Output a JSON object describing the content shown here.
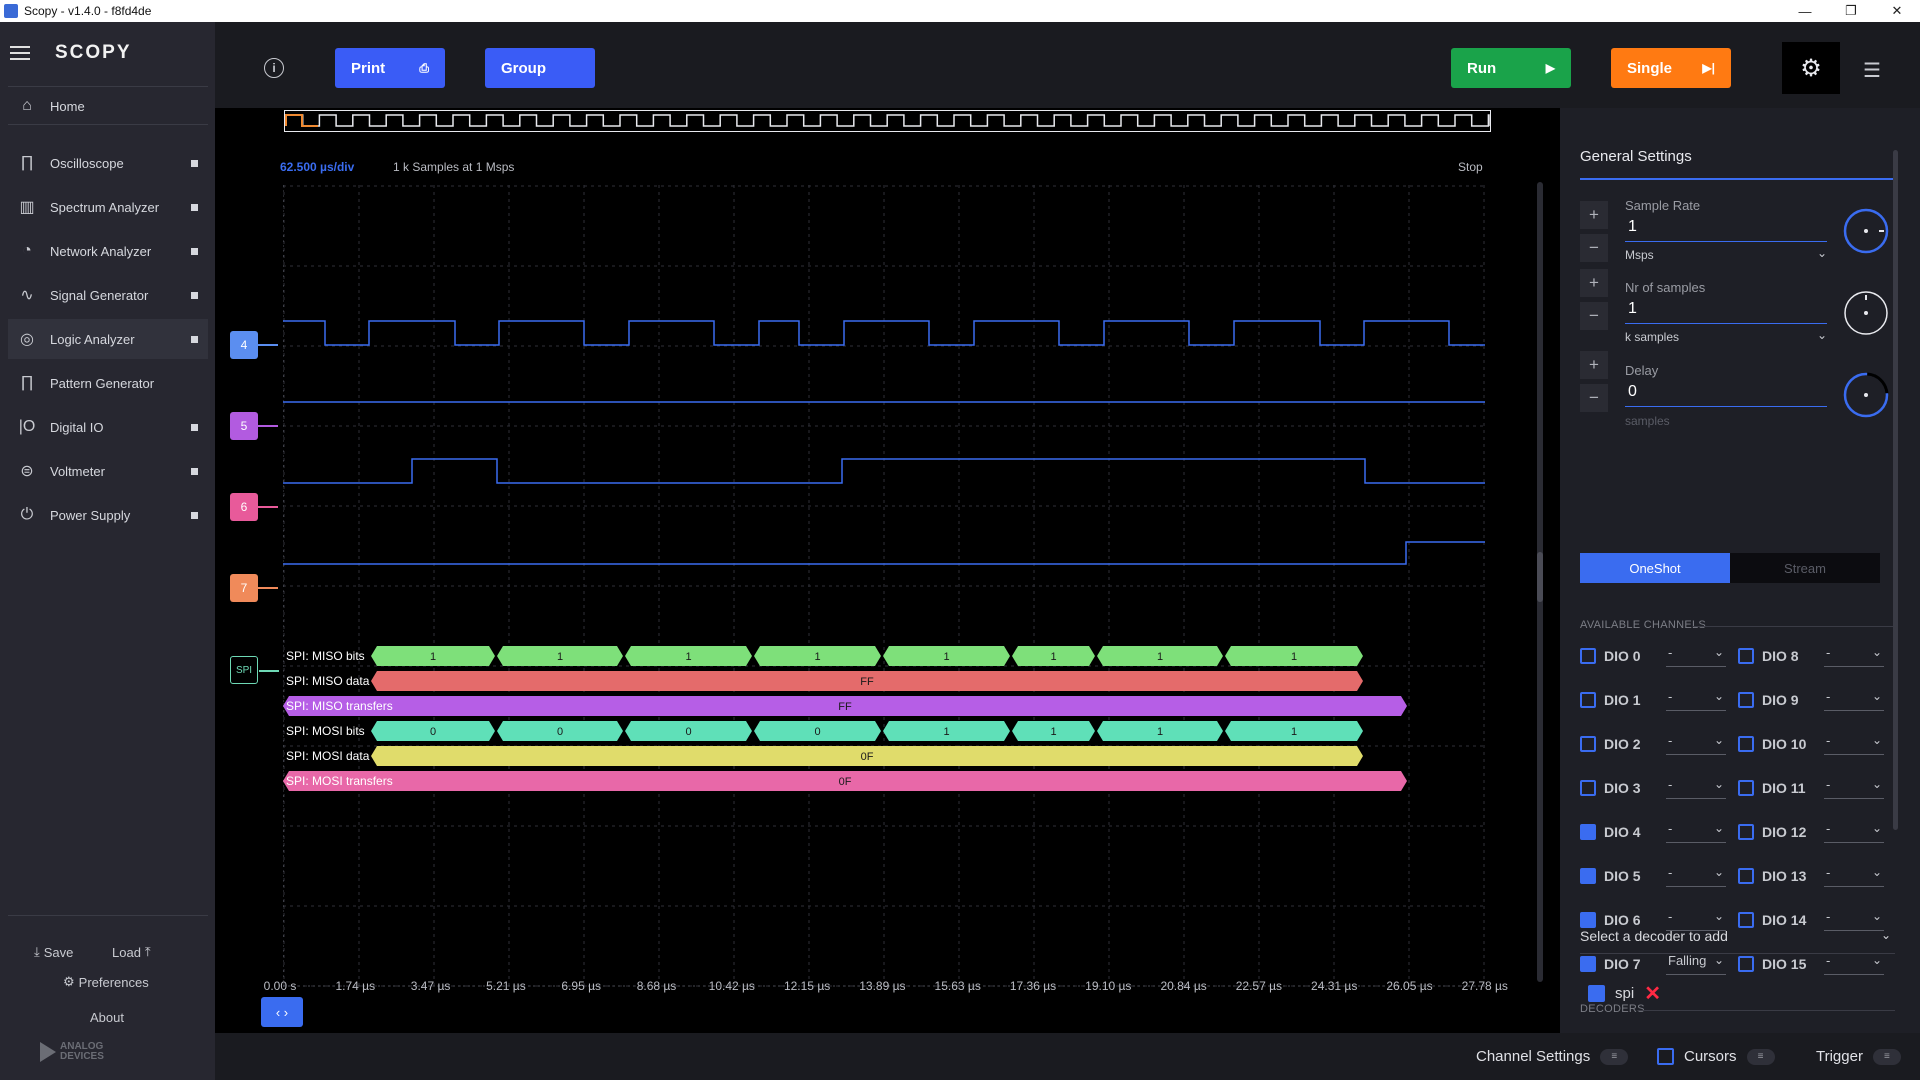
{
  "window": {
    "title": "Scopy - v1.4.0 - f8fd4de",
    "controls": [
      "—",
      "❐",
      "✕"
    ]
  },
  "sidebar": {
    "logo": "SCOPY",
    "home_label": "Home",
    "items": [
      {
        "label": "Oscilloscope",
        "icon": "oscilloscope-icon"
      },
      {
        "label": "Spectrum Analyzer",
        "icon": "spectrum-icon"
      },
      {
        "label": "Network Analyzer",
        "icon": "network-icon"
      },
      {
        "label": "Signal Generator",
        "icon": "signal-icon"
      },
      {
        "label": "Logic Analyzer",
        "icon": "logic-icon"
      },
      {
        "label": "Pattern Generator",
        "icon": "pattern-icon"
      },
      {
        "label": "Digital IO",
        "icon": "digital-io-icon"
      },
      {
        "label": "Voltmeter",
        "icon": "voltmeter-icon"
      },
      {
        "label": "Power Supply",
        "icon": "power-icon"
      }
    ],
    "save_label": "Save",
    "load_label": "Load",
    "preferences_label": "Preferences",
    "about_label": "About",
    "brand_line1": "ANALOG",
    "brand_line2": "DEVICES"
  },
  "toolbar": {
    "print_label": "Print",
    "group_label": "Group",
    "run_label": "Run",
    "single_label": "Single",
    "colors": {
      "print": "#3a5cf6",
      "group": "#3a5cf6",
      "run": "#1aa34a",
      "single": "#ff7a12"
    }
  },
  "plot": {
    "time_div": "62.500 µs/div",
    "samples_info": "1 k Samples at 1 Msps",
    "status": "Stop",
    "x_ticks": [
      "0.00 s",
      "1.74 µs",
      "3.47 µs",
      "5.21 µs",
      "6.95 µs",
      "8.68 µs",
      "10.42 µs",
      "12.15 µs",
      "13.89 µs",
      "15.63 µs",
      "17.36 µs",
      "19.10 µs",
      "20.84 µs",
      "22.57 µs",
      "24.31 µs",
      "26.05 µs",
      "27.78 µs"
    ],
    "channels": [
      {
        "label": "4",
        "color": "#5b8ef0"
      },
      {
        "label": "5",
        "color": "#b25be0"
      },
      {
        "label": "6",
        "color": "#e85a9a"
      },
      {
        "label": "7",
        "color": "#f08a5a"
      },
      {
        "label": "SPI",
        "color": "#6ed9b5"
      }
    ],
    "decoder_rows": [
      {
        "label": "SPI: MISO bits",
        "color": "#7ee07a",
        "values": [
          "1",
          "1",
          "1",
          "1",
          "1",
          "1",
          "1",
          "1"
        ]
      },
      {
        "label": "SPI: MISO data",
        "color": "#e46b6b",
        "values": [
          "FF"
        ]
      },
      {
        "label": "SPI: MISO transfers",
        "color": "#b65ee6",
        "values": [
          "FF"
        ]
      },
      {
        "label": "SPI: MOSI bits",
        "color": "#5fe0b8",
        "values": [
          "0",
          "0",
          "0",
          "0",
          "1",
          "1",
          "1",
          "1"
        ]
      },
      {
        "label": "SPI: MOSI data",
        "color": "#e0dc6b",
        "values": [
          "0F"
        ]
      },
      {
        "label": "SPI: MOSI transfers",
        "color": "#e868a8",
        "values": [
          "0F"
        ]
      }
    ]
  },
  "settings": {
    "title": "General Settings",
    "sample_rate": {
      "label": "Sample Rate",
      "value": "1",
      "unit": "Msps"
    },
    "nr_samples": {
      "label": "Nr of samples",
      "value": "1",
      "unit": "k samples"
    },
    "delay": {
      "label": "Delay",
      "value": "0",
      "unit": "samples"
    },
    "mode_oneshot": "OneShot",
    "mode_stream": "Stream",
    "available_channels_label": "AVAILABLE CHANNELS",
    "channels_left": [
      {
        "name": "DIO 0",
        "checked": false,
        "trigger": "-"
      },
      {
        "name": "DIO 1",
        "checked": false,
        "trigger": "-"
      },
      {
        "name": "DIO 2",
        "checked": false,
        "trigger": "-"
      },
      {
        "name": "DIO 3",
        "checked": false,
        "trigger": "-"
      },
      {
        "name": "DIO 4",
        "checked": true,
        "trigger": "-"
      },
      {
        "name": "DIO 5",
        "checked": true,
        "trigger": "-"
      },
      {
        "name": "DIO 6",
        "checked": true,
        "trigger": "-"
      },
      {
        "name": "DIO 7",
        "checked": true,
        "trigger": "Falling"
      }
    ],
    "channels_right": [
      {
        "name": "DIO 8",
        "checked": false,
        "trigger": "-"
      },
      {
        "name": "DIO 9",
        "checked": false,
        "trigger": "-"
      },
      {
        "name": "DIO 10",
        "checked": false,
        "trigger": "-"
      },
      {
        "name": "DIO 11",
        "checked": false,
        "trigger": "-"
      },
      {
        "name": "DIO 12",
        "checked": false,
        "trigger": "-"
      },
      {
        "name": "DIO 13",
        "checked": false,
        "trigger": "-"
      },
      {
        "name": "DIO 14",
        "checked": false,
        "trigger": "-"
      },
      {
        "name": "DIO 15",
        "checked": false,
        "trigger": "-"
      }
    ],
    "decoders_label": "DECODERS",
    "decoder_placeholder": "Select a decoder to add",
    "decoder_item": "spi"
  },
  "bottom": {
    "channel_settings": "Channel Settings",
    "cursors": "Cursors",
    "trigger": "Trigger"
  }
}
